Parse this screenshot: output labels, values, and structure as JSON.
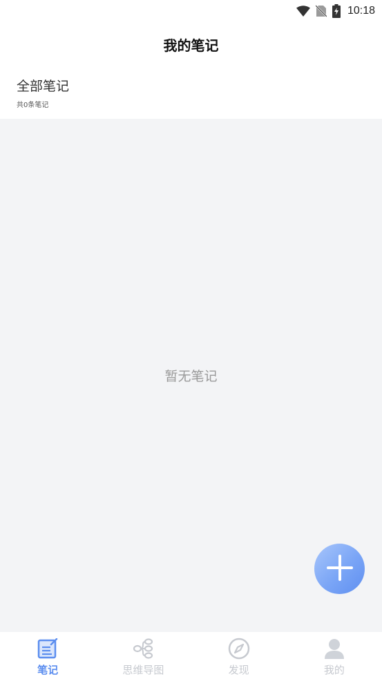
{
  "status_bar": {
    "time": "10:18",
    "icons": [
      "wifi-icon",
      "no-sim-icon",
      "battery-charging-icon"
    ]
  },
  "header": {
    "title": "我的笔记"
  },
  "section": {
    "title": "全部笔记",
    "count": "共0条笔记"
  },
  "content": {
    "empty_text": "暂无笔记"
  },
  "fab": {
    "icon": "plus-icon"
  },
  "bottom_nav": {
    "items": [
      {
        "label": "笔记",
        "icon": "note-icon",
        "active": true
      },
      {
        "label": "思维导图",
        "icon": "mindmap-icon",
        "active": false
      },
      {
        "label": "发现",
        "icon": "compass-icon",
        "active": false
      },
      {
        "label": "我的",
        "icon": "profile-icon",
        "active": false
      }
    ]
  },
  "colors": {
    "accent": "#5b8def",
    "inactive": "#c6c9cf",
    "content_bg": "#f3f4f6"
  }
}
